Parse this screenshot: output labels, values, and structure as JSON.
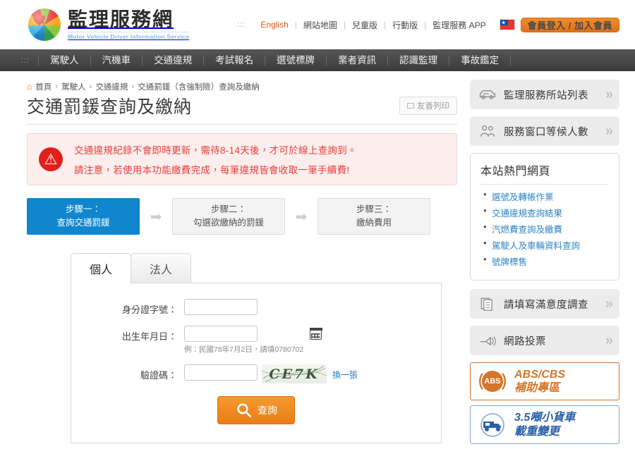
{
  "header": {
    "logo_cn": "監理服務網",
    "logo_en": "Motor Vehicle Driver Information Service",
    "accessibility_mark": ":::",
    "top_links": [
      "English",
      "網站地圖",
      "兒童版",
      "行動版",
      "監理服務 APP"
    ],
    "member_button": "會員登入 / 加入會員",
    "flag_icon": "taiwan-flag-icon"
  },
  "nav": {
    "accessibility_mark": ":::",
    "items": [
      "駕駛人",
      "汽機車",
      "交通違規",
      "考試報名",
      "選號標牌",
      "業者資訊",
      "認識監理",
      "事故鑑定"
    ]
  },
  "breadcrumb": {
    "home_icon": "home-icon",
    "items": [
      "首頁",
      "駕駛人",
      "交通違規",
      "交通罰鍰（含強制險）查詢及繳納"
    ],
    "separator": "›"
  },
  "page": {
    "title": "交通罰鍰查詢及繳納",
    "print_label": "友善列印",
    "print_icon": "printer-icon"
  },
  "alert": {
    "icon": "warning-icon",
    "line1": "交通違規紀錄不會即時更新，需待8-14天後，才可於線上查詢到。",
    "line2": "請注意，若使用本功能繳費完成，每筆違規皆會收取一筆手續費!",
    "color": "#e8403b",
    "bg": "#fdeeee"
  },
  "steps": {
    "arrow": "➡",
    "items": [
      {
        "line1": "步驟一：",
        "line2": "查詢交通罰鍰",
        "state": "active"
      },
      {
        "line1": "步驟二：",
        "line2": "勾選欲繳納的罰鍰",
        "state": "idle"
      },
      {
        "line1": "步驟三：",
        "line2": "繳納費用",
        "state": "idle"
      }
    ],
    "active_color": "#0f86ce"
  },
  "form": {
    "tabs": [
      {
        "label": "個人",
        "active": true
      },
      {
        "label": "法人",
        "active": false
      }
    ],
    "id_label": "身分證字號：",
    "id_value": "",
    "id_placeholder": "",
    "birth_label": "出生年月日：",
    "birth_value": "",
    "birth_placeholder": "",
    "birth_hint": "例：民國78年7月2日，請填0780702",
    "calendar_icon": "calendar-icon",
    "captcha_label": "驗證碼：",
    "captcha_value": "",
    "captcha_text": "CE7K",
    "captcha_refresh": "換一張",
    "submit_label": "查詢",
    "submit_icon": "search-icon",
    "submit_color": "#ea7c16"
  },
  "sidebar": {
    "buttons_top": [
      {
        "label": "監理服務所站列表",
        "icon": "car-icon"
      },
      {
        "label": "服務窗口等候人數",
        "icon": "people-icon"
      }
    ],
    "hot": {
      "title": "本站熱門網頁",
      "links": [
        "選號及轉帳作業",
        "交通違規查詢結果",
        "汽燃費查詢及繳費",
        "駕駛人及車輛資料查詢",
        "號牌標售"
      ],
      "link_color": "#2f84c4"
    },
    "buttons_bottom": [
      {
        "label": "請填寫滿意度調查",
        "icon": "document-icon"
      },
      {
        "label": "網路投票",
        "icon": "megaphone-icon"
      }
    ],
    "chevron": "»",
    "banners": [
      {
        "icon": "abs-icon",
        "badge": "ABS",
        "line1": "ABS/CBS",
        "line2": "補助專區",
        "color": "#d4762a"
      },
      {
        "icon": "truck-icon",
        "badge": "",
        "line1": "3.5噸小貨車",
        "line2": "載重變更",
        "color": "#2a5fa8"
      }
    ]
  }
}
